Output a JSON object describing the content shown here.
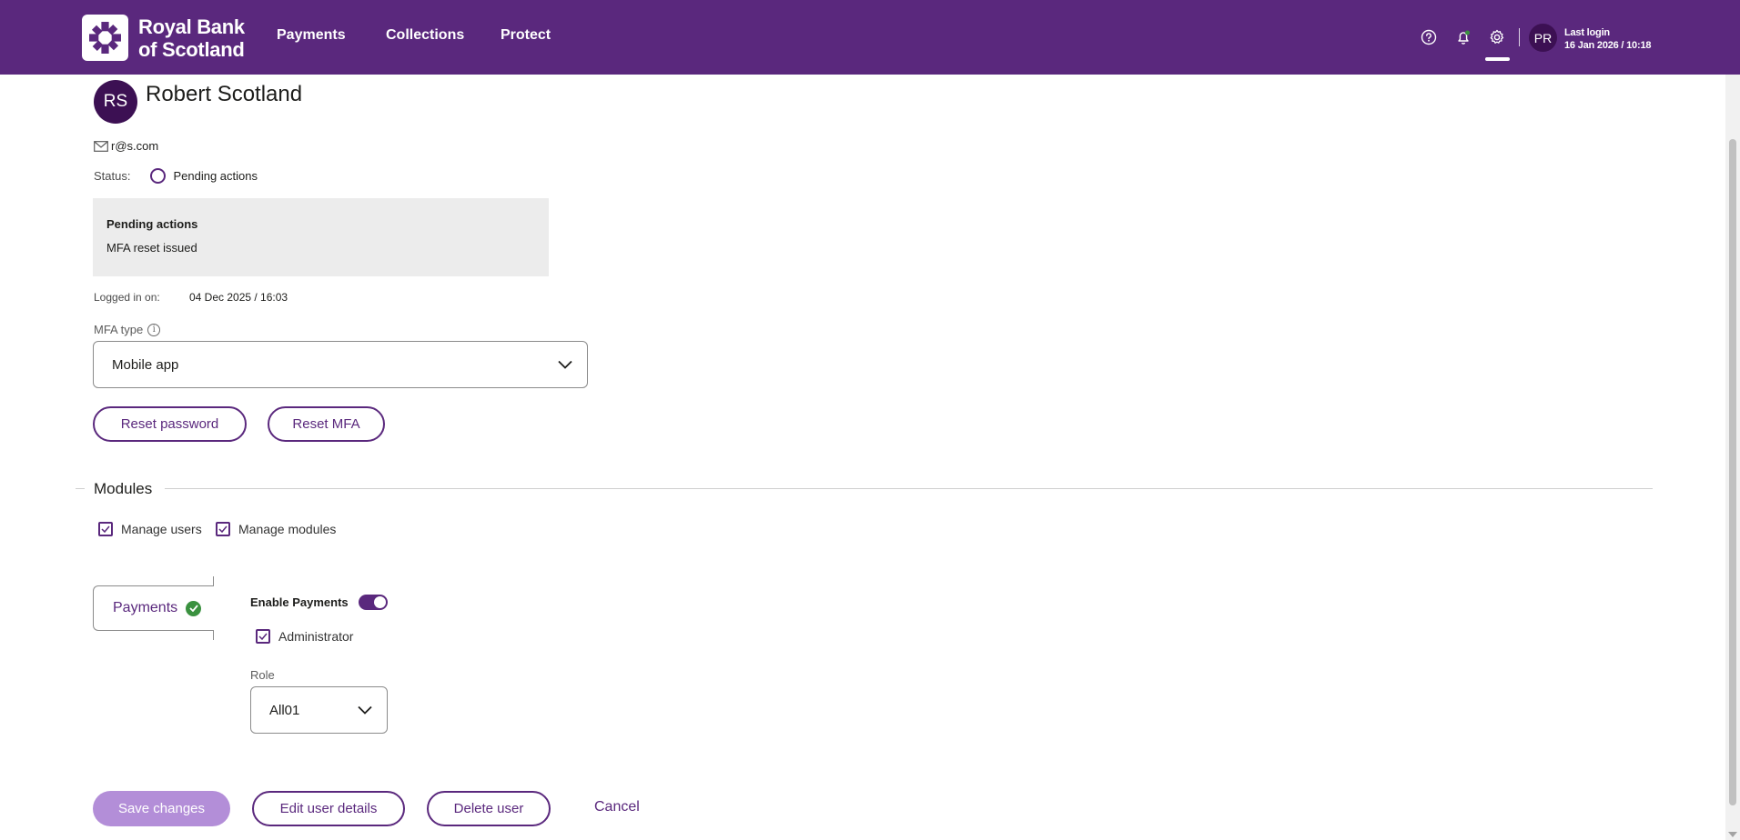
{
  "header": {
    "brand_line1": "Royal Bank",
    "brand_line2": "of Scotland",
    "nav": [
      "Payments",
      "Collections",
      "Protect"
    ],
    "avatar_initials": "PR",
    "last_login_label": "Last login",
    "last_login_value": "16 Jan 2026 / 10:18",
    "brand_color": "#5a287d"
  },
  "user": {
    "initials": "RS",
    "name": "Robert Scotland",
    "email": "r@s.com",
    "status_label": "Status:",
    "status_value": "Pending actions"
  },
  "pending": {
    "title": "Pending actions",
    "items": [
      "MFA reset issued"
    ]
  },
  "login": {
    "label": "Logged in on:",
    "value": "04 Dec 2025 / 16:03"
  },
  "mfa": {
    "label": "MFA type",
    "selected": "Mobile app"
  },
  "actions": {
    "reset_password": "Reset password",
    "reset_mfa": "Reset MFA"
  },
  "modules": {
    "title": "Modules",
    "manage_users": "Manage users",
    "manage_modules": "Manage modules",
    "tab": "Payments",
    "enable_label": "Enable Payments",
    "enabled": true,
    "administrator": "Administrator",
    "role_label": "Role",
    "role_selected": "All01"
  },
  "footer": {
    "save": "Save changes",
    "edit": "Edit user details",
    "delete": "Delete user",
    "cancel": "Cancel"
  }
}
